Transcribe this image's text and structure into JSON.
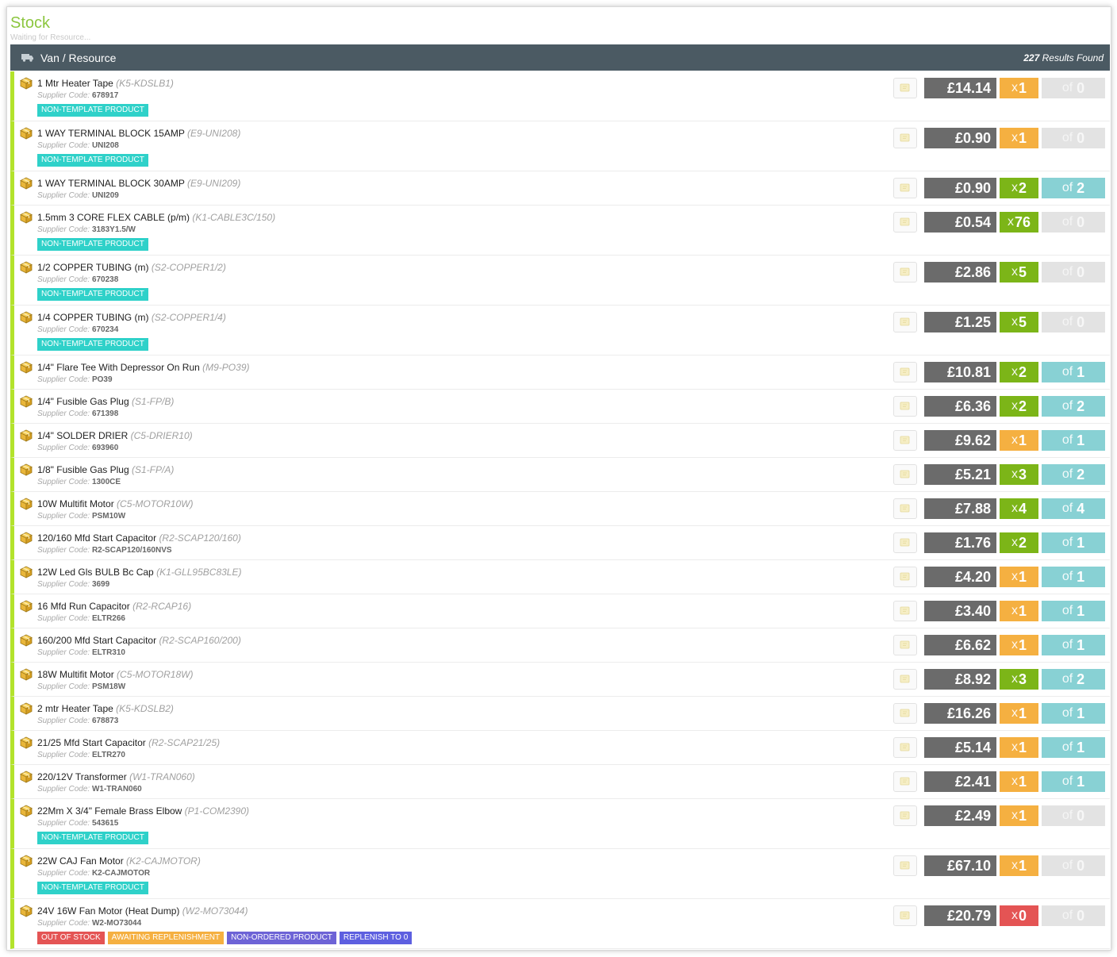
{
  "page": {
    "title": "Stock",
    "subtitle": "Waiting for Resource..."
  },
  "header": {
    "title": "Van / Resource",
    "count": "227",
    "count_suffix": "Results Found",
    "icon": "truck-icon"
  },
  "labels": {
    "supplier_code": "Supplier Code:",
    "qty_prefix": "x",
    "of_prefix": "of"
  },
  "colors": {
    "accent": "#8cc63f",
    "header_bg": "#4b5a63",
    "row_border": "#b3e32c",
    "price_bg": "#6b6b6b",
    "qty_orange": "#f5b041",
    "qty_green": "#7cb518",
    "qty_red": "#e45454",
    "of_teal": "#88d1d4",
    "of_gray": "#e3e3e3",
    "tag_teal": "#2fd1c9"
  },
  "items": [
    {
      "name": "1 Mtr Heater Tape",
      "code": "(K5-KDSLB1)",
      "supplier": "678917",
      "tags": [
        "NON-TEMPLATE PRODUCT"
      ],
      "price": "£14.14",
      "qty": "1",
      "qty_color": "orange",
      "of": "0",
      "of_color": "gray"
    },
    {
      "name": "1 WAY TERMINAL BLOCK 15AMP",
      "code": "(E9-UNI208)",
      "supplier": "UNI208",
      "tags": [
        "NON-TEMPLATE PRODUCT"
      ],
      "price": "£0.90",
      "qty": "1",
      "qty_color": "orange",
      "of": "0",
      "of_color": "gray"
    },
    {
      "name": "1 WAY TERMINAL BLOCK 30AMP",
      "code": "(E9-UNI209)",
      "supplier": "UNI209",
      "tags": [],
      "price": "£0.90",
      "qty": "2",
      "qty_color": "green",
      "of": "2",
      "of_color": "teal"
    },
    {
      "name": "1.5mm 3 CORE FLEX CABLE (p/m)",
      "code": "(K1-CABLE3C/150)",
      "supplier": "3183Y1.5/W",
      "tags": [
        "NON-TEMPLATE PRODUCT"
      ],
      "price": "£0.54",
      "qty": "76",
      "qty_color": "green",
      "of": "0",
      "of_color": "gray"
    },
    {
      "name": "1/2 COPPER TUBING (m)",
      "code": "(S2-COPPER1/2)",
      "supplier": "670238",
      "tags": [
        "NON-TEMPLATE PRODUCT"
      ],
      "price": "£2.86",
      "qty": "5",
      "qty_color": "green",
      "of": "0",
      "of_color": "gray"
    },
    {
      "name": "1/4 COPPER TUBING (m)",
      "code": "(S2-COPPER1/4)",
      "supplier": "670234",
      "tags": [
        "NON-TEMPLATE PRODUCT"
      ],
      "price": "£1.25",
      "qty": "5",
      "qty_color": "green",
      "of": "0",
      "of_color": "gray"
    },
    {
      "name": "1/4\" Flare Tee With Depressor On Run",
      "code": "(M9-PO39)",
      "supplier": "PO39",
      "tags": [],
      "price": "£10.81",
      "qty": "2",
      "qty_color": "green",
      "of": "1",
      "of_color": "teal"
    },
    {
      "name": "1/4\" Fusible Gas Plug",
      "code": "(S1-FP/B)",
      "supplier": "671398",
      "tags": [],
      "price": "£6.36",
      "qty": "2",
      "qty_color": "green",
      "of": "2",
      "of_color": "teal"
    },
    {
      "name": "1/4\" SOLDER DRIER",
      "code": "(C5-DRIER10)",
      "supplier": "693960",
      "tags": [],
      "price": "£9.62",
      "qty": "1",
      "qty_color": "orange",
      "of": "1",
      "of_color": "teal"
    },
    {
      "name": "1/8\" Fusible Gas Plug",
      "code": "(S1-FP/A)",
      "supplier": "1300CE",
      "tags": [],
      "price": "£5.21",
      "qty": "3",
      "qty_color": "green",
      "of": "2",
      "of_color": "teal"
    },
    {
      "name": "10W Multifit Motor",
      "code": "(C5-MOTOR10W)",
      "supplier": "PSM10W",
      "tags": [],
      "price": "£7.88",
      "qty": "4",
      "qty_color": "green",
      "of": "4",
      "of_color": "teal"
    },
    {
      "name": "120/160 Mfd Start Capacitor",
      "code": "(R2-SCAP120/160)",
      "supplier": "R2-SCAP120/160NVS",
      "tags": [],
      "price": "£1.76",
      "qty": "2",
      "qty_color": "green",
      "of": "1",
      "of_color": "teal"
    },
    {
      "name": "12W Led Gls BULB Bc Cap",
      "code": "(K1-GLL95BC83LE)",
      "supplier": "3699",
      "tags": [],
      "price": "£4.20",
      "qty": "1",
      "qty_color": "orange",
      "of": "1",
      "of_color": "teal"
    },
    {
      "name": "16 Mfd Run Capacitor",
      "code": "(R2-RCAP16)",
      "supplier": "ELTR266",
      "tags": [],
      "price": "£3.40",
      "qty": "1",
      "qty_color": "orange",
      "of": "1",
      "of_color": "teal"
    },
    {
      "name": "160/200 Mfd Start Capacitor",
      "code": "(R2-SCAP160/200)",
      "supplier": "ELTR310",
      "tags": [],
      "price": "£6.62",
      "qty": "1",
      "qty_color": "orange",
      "of": "1",
      "of_color": "teal"
    },
    {
      "name": "18W Multifit Motor",
      "code": "(C5-MOTOR18W)",
      "supplier": "PSM18W",
      "tags": [],
      "price": "£8.92",
      "qty": "3",
      "qty_color": "green",
      "of": "2",
      "of_color": "teal"
    },
    {
      "name": "2 mtr Heater Tape",
      "code": "(K5-KDSLB2)",
      "supplier": "678873",
      "tags": [],
      "price": "£16.26",
      "qty": "1",
      "qty_color": "orange",
      "of": "1",
      "of_color": "teal"
    },
    {
      "name": "21/25 Mfd Start Capacitor",
      "code": "(R2-SCAP21/25)",
      "supplier": "ELTR270",
      "tags": [],
      "price": "£5.14",
      "qty": "1",
      "qty_color": "orange",
      "of": "1",
      "of_color": "teal"
    },
    {
      "name": "220/12V Transformer",
      "code": "(W1-TRAN060)",
      "supplier": "W1-TRAN060",
      "tags": [],
      "price": "£2.41",
      "qty": "1",
      "qty_color": "orange",
      "of": "1",
      "of_color": "teal"
    },
    {
      "name": "22Mm X 3/4\" Female Brass Elbow",
      "code": "(P1-COM2390)",
      "supplier": "543615",
      "tags": [
        "NON-TEMPLATE PRODUCT"
      ],
      "price": "£2.49",
      "qty": "1",
      "qty_color": "orange",
      "of": "0",
      "of_color": "gray"
    },
    {
      "name": "22W CAJ Fan Motor",
      "code": "(K2-CAJMOTOR)",
      "supplier": "K2-CAJMOTOR",
      "tags": [
        "NON-TEMPLATE PRODUCT"
      ],
      "price": "£67.10",
      "qty": "1",
      "qty_color": "orange",
      "of": "0",
      "of_color": "gray"
    },
    {
      "name": "24V 16W Fan Motor (Heat Dump)",
      "code": "(W2-MO73044)",
      "supplier": "W2-MO73044",
      "tags": [
        "OUT OF STOCK",
        "AWAITING REPLENISHMENT",
        "NON-ORDERED PRODUCT",
        "REPLENISH TO 0"
      ],
      "price": "£20.79",
      "qty": "0",
      "qty_color": "red",
      "of": "0",
      "of_color": "gray"
    }
  ]
}
